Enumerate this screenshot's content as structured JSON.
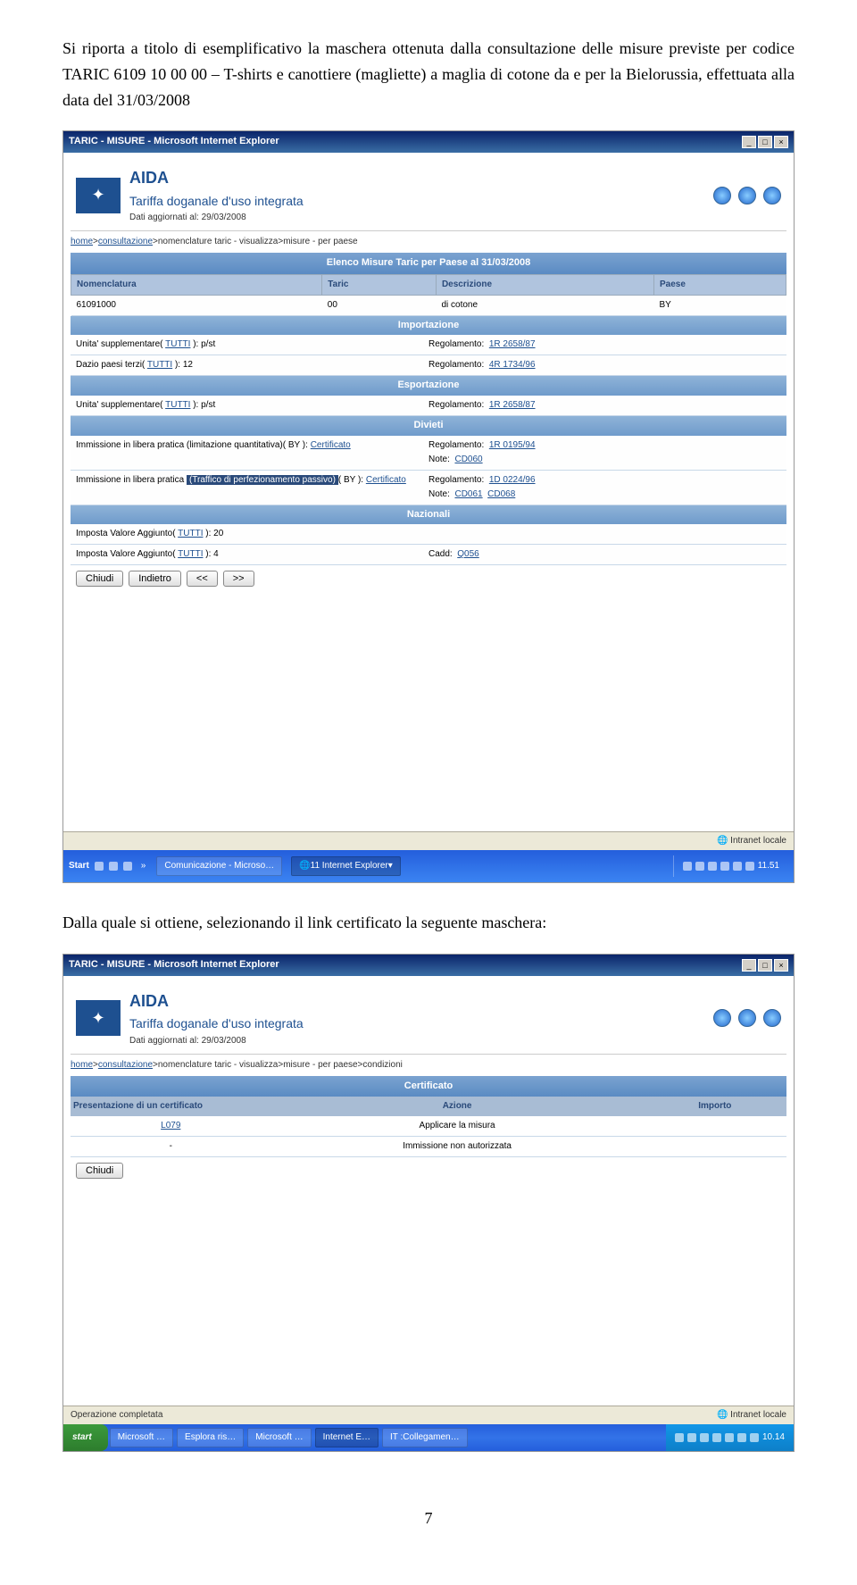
{
  "intro": "Si riporta a titolo di esemplificativo la maschera ottenuta dalla consultazione delle misure previste per codice TARIC 6109 10 00 00 – T-shirts e canottiere (magliette) a maglia di cotone da e per la Bielorussia, effettuata alla data del 31/03/2008",
  "screenshot1": {
    "titleBar": "TARIC - MISURE - Microsoft Internet Explorer",
    "app": {
      "title": "AIDA",
      "subtitle": "Tariffa doganale d'uso integrata",
      "dateLabel": "Dati aggiornati al: 29/03/2008"
    },
    "breadcrumb": {
      "home": "home",
      "cons": "consultazione",
      "rest": ">nomenclature taric - visualizza>misure - per paese"
    },
    "listTitle": "Elenco Misure Taric per Paese al 31/03/2008",
    "cols": {
      "nom": "Nomenclatura",
      "taric": "Taric",
      "desc": "Descrizione",
      "paese": "Paese"
    },
    "row1": {
      "nom": "61091000",
      "taric": "00",
      "desc": "di cotone",
      "paese": "BY"
    },
    "sections": {
      "import": "Importazione",
      "export": "Esportazione",
      "divieti": "Divieti",
      "nazionali": "Nazionali"
    },
    "imp": {
      "r1l": "Unita' supplementare( TUTTI ): p/st",
      "r1r": "Regolamento:  1R 2658/87",
      "r2l": "Dazio paesi terzi( TUTTI ): 12",
      "r2r": "Regolamento:  4R 1734/96"
    },
    "exp": {
      "r1l": "Unita' supplementare( TUTTI ): p/st",
      "r1r": "Regolamento:  1R 2658/87"
    },
    "div": {
      "r1l_a": "Immissione in libera pratica (limitazione quantitativa)( BY ): ",
      "r1l_b": "Certificato",
      "r1r_a": "Regolamento:  1R 0195/94",
      "r1r_b": "Note:  CD060",
      "r2l_a": "Immissione in libera pratica ",
      "r2l_box": "(Traffico di perfezionamento passivo)",
      "r2l_c": "( BY ): ",
      "r2l_d": "Certificato",
      "r2r_a": "Regolamento:  1D 0224/96",
      "r2r_b": "Note:  CD061  CD068"
    },
    "naz": {
      "r1l": "Imposta Valore Aggiunto( TUTTI ): 20",
      "r2l": "Imposta Valore Aggiunto( TUTTI ): 4",
      "r2r": "Cadd:  Q056"
    },
    "buttons": {
      "chiudi": "Chiudi",
      "indietro": "Indietro",
      "prev": "<<",
      "next": ">>"
    },
    "status": {
      "right": "Intranet locale"
    },
    "taskbar": {
      "start": "Start",
      "item1": "Comunicazione - Microso…",
      "item2": "11 Internet Explorer",
      "time": "11.51"
    }
  },
  "conclusion": "Dalla quale si ottiene, selezionando il link certificato la seguente maschera:",
  "screenshot2": {
    "titleBar": "TARIC - MISURE - Microsoft Internet Explorer",
    "app": {
      "title": "AIDA",
      "subtitle": "Tariffa doganale d'uso integrata",
      "dateLabel": "Dati aggiornati al: 29/03/2008"
    },
    "breadcrumb": {
      "home": "home",
      "cons": "consultazione",
      "rest": ">nomenclature taric - visualizza>misure - per paese>condizioni"
    },
    "certTitle": "Certificato",
    "cols": {
      "pres": "Presentazione di un certificato",
      "azione": "Azione",
      "importo": "Importo"
    },
    "rows": {
      "r1c1": "L079",
      "r1c2": "Applicare la misura",
      "r1c3": "",
      "r2c1": "-",
      "r2c2": "Immissione non autorizzata",
      "r2c3": ""
    },
    "buttons": {
      "chiudi": "Chiudi"
    },
    "status": {
      "left": "Operazione completata",
      "right": "Intranet locale"
    },
    "taskbar": {
      "start": "start",
      "items": [
        "Microsoft …",
        "Esplora ris…",
        "Microsoft …",
        "Internet E…",
        "Collegamen…"
      ],
      "time": "10.14"
    }
  },
  "pageNum": "7"
}
